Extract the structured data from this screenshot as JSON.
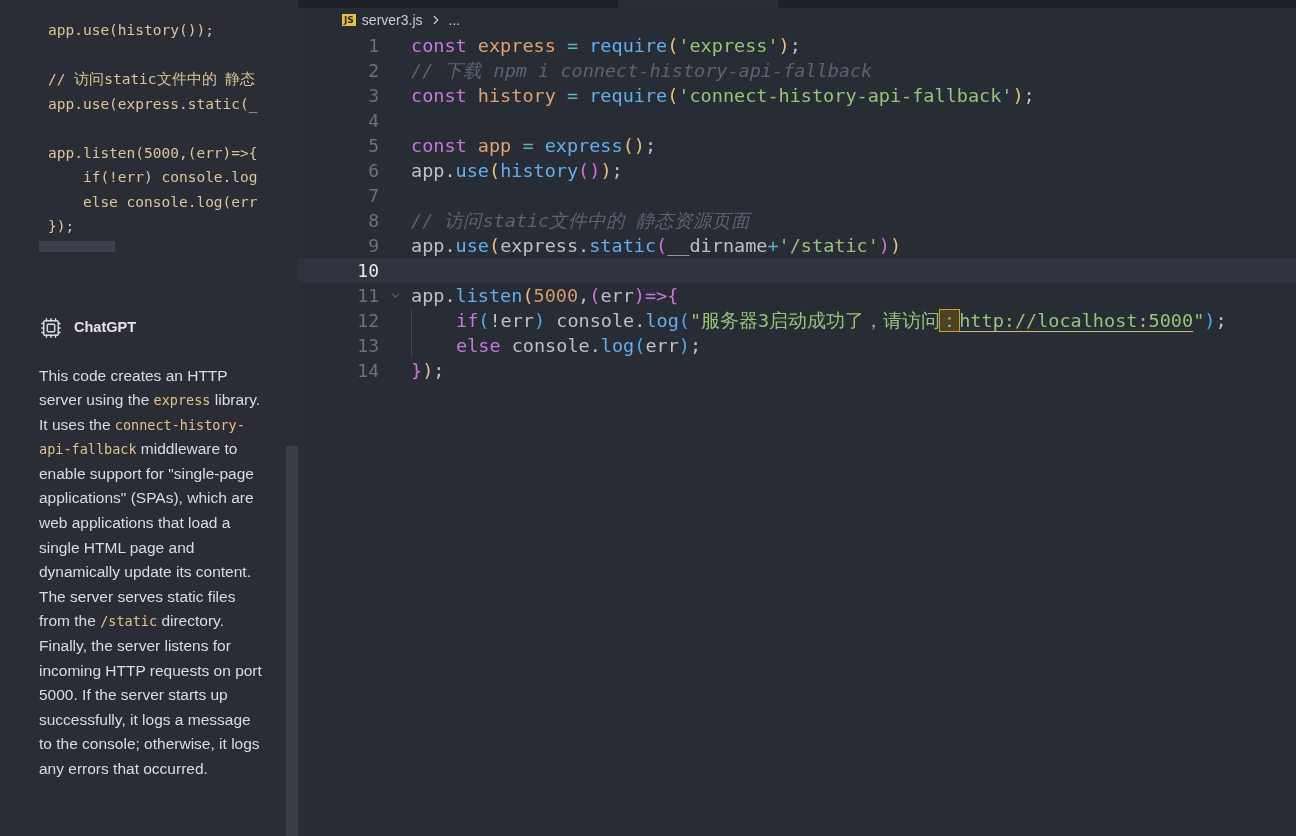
{
  "side_panel": {
    "code_blocks": [
      [
        "app.use(history());"
      ],
      [
        "// 访问static文件中的 静态",
        "app.use(express.static(_"
      ],
      [
        "app.listen(5000,(err)=>{",
        "    if(!err) console.log",
        "    else console.log(err",
        "});"
      ]
    ],
    "assistant": {
      "name": "ChatGPT",
      "segments": [
        {
          "kind": "text",
          "text": "This code creates an HTTP server using the "
        },
        {
          "kind": "code",
          "text": "express"
        },
        {
          "kind": "text",
          "text": " library. It uses the "
        },
        {
          "kind": "code",
          "text": "connect-history-api-fallback"
        },
        {
          "kind": "text",
          "text": " middleware to enable support for \"single-page applications\" (SPAs), which are web applications that load a single HTML page and dynamically update its content. The server serves static files from the "
        },
        {
          "kind": "code",
          "text": "/static"
        },
        {
          "kind": "text",
          "text": " directory. Finally, the server listens for incoming HTTP requests on port 5000. If the server starts up successfully, it logs a message to the console; otherwise, it logs any errors that occurred."
        }
      ]
    }
  },
  "editor": {
    "breadcrumb": {
      "file_type": "JS",
      "file": "server3.js",
      "more": "..."
    },
    "lines": [
      {
        "number": "1",
        "current": false,
        "tokens": [
          {
            "kind": "keyword",
            "text": "const "
          },
          {
            "kind": "variable",
            "text": "express "
          },
          {
            "kind": "operator",
            "text": "= "
          },
          {
            "kind": "function",
            "text": "require"
          },
          {
            "kind": "bracket1",
            "text": "("
          },
          {
            "kind": "string",
            "text": "'express'"
          },
          {
            "kind": "bracket1",
            "text": ")"
          },
          {
            "kind": "plain",
            "text": ";"
          }
        ]
      },
      {
        "number": "2",
        "current": false,
        "tokens": [
          {
            "kind": "comment",
            "text": "// 下载 npm i connect-history-api-fallback"
          }
        ]
      },
      {
        "number": "3",
        "current": false,
        "tokens": [
          {
            "kind": "keyword",
            "text": "const "
          },
          {
            "kind": "variable",
            "text": "history "
          },
          {
            "kind": "operator",
            "text": "= "
          },
          {
            "kind": "function",
            "text": "require"
          },
          {
            "kind": "bracket1",
            "text": "("
          },
          {
            "kind": "string",
            "text": "'connect-history-api-fallback'"
          },
          {
            "kind": "bracket1",
            "text": ")"
          },
          {
            "kind": "plain",
            "text": ";"
          }
        ]
      },
      {
        "number": "4",
        "current": false
      },
      {
        "number": "5",
        "current": false,
        "tokens": [
          {
            "kind": "keyword",
            "text": "const "
          },
          {
            "kind": "variable",
            "text": "app "
          },
          {
            "kind": "operator",
            "text": "= "
          },
          {
            "kind": "function",
            "text": "express"
          },
          {
            "kind": "bracket1",
            "text": "()"
          },
          {
            "kind": "plain",
            "text": ";"
          }
        ]
      },
      {
        "number": "6",
        "current": false,
        "tokens": [
          {
            "kind": "plain",
            "text": "app."
          },
          {
            "kind": "function",
            "text": "use"
          },
          {
            "kind": "bracket1",
            "text": "("
          },
          {
            "kind": "function",
            "text": "history"
          },
          {
            "kind": "bracket2",
            "text": "()"
          },
          {
            "kind": "bracket1",
            "text": ")"
          },
          {
            "kind": "plain",
            "text": ";"
          }
        ]
      },
      {
        "number": "7",
        "current": false
      },
      {
        "number": "8",
        "current": false,
        "tokens": [
          {
            "kind": "comment",
            "text": "// 访问static文件中的 静态资源页面"
          }
        ]
      },
      {
        "number": "9",
        "current": false,
        "tokens": [
          {
            "kind": "plain",
            "text": "app."
          },
          {
            "kind": "function",
            "text": "use"
          },
          {
            "kind": "bracket1",
            "text": "("
          },
          {
            "kind": "plain",
            "text": "express."
          },
          {
            "kind": "function",
            "text": "static"
          },
          {
            "kind": "bracket2",
            "text": "("
          },
          {
            "kind": "plain",
            "text": "__dirname"
          },
          {
            "kind": "operator",
            "text": "+"
          },
          {
            "kind": "string",
            "text": "'/static'"
          },
          {
            "kind": "bracket2",
            "text": ")"
          },
          {
            "kind": "bracket1",
            "text": ")"
          }
        ]
      },
      {
        "number": "10",
        "current": true
      },
      {
        "number": "11",
        "current": false,
        "foldable": true,
        "tokens": [
          {
            "kind": "plain",
            "text": "app."
          },
          {
            "kind": "function",
            "text": "listen"
          },
          {
            "kind": "bracket1",
            "text": "("
          },
          {
            "kind": "number",
            "text": "5000"
          },
          {
            "kind": "plain",
            "text": ","
          },
          {
            "kind": "bracket2",
            "text": "("
          },
          {
            "kind": "plain",
            "text": "err"
          },
          {
            "kind": "bracket2",
            "text": ")"
          },
          {
            "kind": "keyword",
            "text": "=>"
          },
          {
            "kind": "bracket2",
            "text": "{"
          }
        ]
      },
      {
        "number": "12",
        "current": false,
        "indented": true,
        "tokens": [
          {
            "kind": "keyword",
            "text": "if"
          },
          {
            "kind": "bracket3",
            "text": "("
          },
          {
            "kind": "plain",
            "text": "!err"
          },
          {
            "kind": "bracket3",
            "text": ")"
          },
          {
            "kind": "plain",
            "text": " console."
          },
          {
            "kind": "function",
            "text": "log"
          },
          {
            "kind": "bracket3",
            "text": "("
          },
          {
            "kind": "string",
            "text": "\"服务器3启动成功了，请访问"
          },
          {
            "kind": "match",
            "text": "："
          },
          {
            "kind": "link",
            "text": "http://localhost:5000"
          },
          {
            "kind": "string",
            "text": "\""
          },
          {
            "kind": "bracket3",
            "text": ")"
          },
          {
            "kind": "plain",
            "text": ";"
          }
        ]
      },
      {
        "number": "13",
        "current": false,
        "indented": true,
        "tokens": [
          {
            "kind": "keyword",
            "text": "else"
          },
          {
            "kind": "plain",
            "text": " console."
          },
          {
            "kind": "function",
            "text": "log"
          },
          {
            "kind": "bracket3",
            "text": "("
          },
          {
            "kind": "plain",
            "text": "err"
          },
          {
            "kind": "bracket3",
            "text": ")"
          },
          {
            "kind": "plain",
            "text": ";"
          }
        ]
      },
      {
        "number": "14",
        "current": false,
        "tokens": [
          {
            "kind": "bracket2",
            "text": "}"
          },
          {
            "kind": "bracket1",
            "text": ")"
          },
          {
            "kind": "plain",
            "text": ";"
          }
        ]
      }
    ]
  }
}
